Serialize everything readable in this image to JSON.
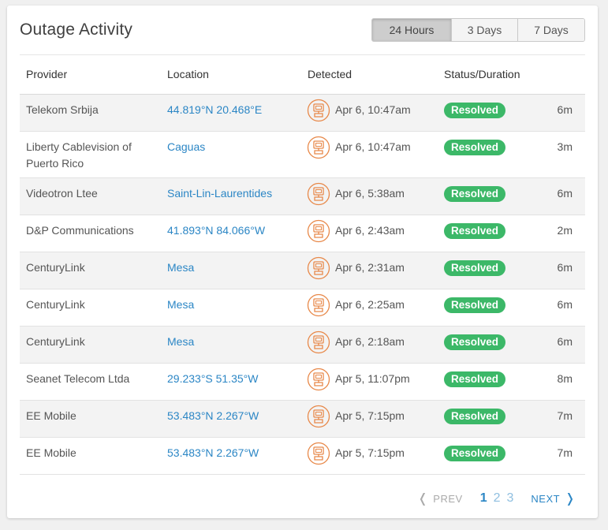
{
  "title": "Outage Activity",
  "range": {
    "options": [
      "24 Hours",
      "3 Days",
      "7 Days"
    ],
    "active": 0
  },
  "columns": [
    "Provider",
    "Location",
    "Detected",
    "Status/Duration"
  ],
  "colors": {
    "link": "#2b86c5",
    "resolved": "#3cb868",
    "icon": "#e8894a"
  },
  "rows": [
    {
      "provider": "Telekom Srbija",
      "location": "44.819°N 20.468°E",
      "detected": "Apr 6, 10:47am",
      "status": "Resolved",
      "duration": "6m"
    },
    {
      "provider": "Liberty Cablevision of Puerto Rico",
      "location": "Caguas",
      "detected": "Apr 6, 10:47am",
      "status": "Resolved",
      "duration": "3m"
    },
    {
      "provider": "Videotron Ltee",
      "location": "Saint-Lin-Laurentides",
      "detected": "Apr 6, 5:38am",
      "status": "Resolved",
      "duration": "6m"
    },
    {
      "provider": "D&P Communications",
      "location": "41.893°N 84.066°W",
      "detected": "Apr 6, 2:43am",
      "status": "Resolved",
      "duration": "2m"
    },
    {
      "provider": "CenturyLink",
      "location": "Mesa",
      "detected": "Apr 6, 2:31am",
      "status": "Resolved",
      "duration": "6m"
    },
    {
      "provider": "CenturyLink",
      "location": "Mesa",
      "detected": "Apr 6, 2:25am",
      "status": "Resolved",
      "duration": "6m"
    },
    {
      "provider": "CenturyLink",
      "location": "Mesa",
      "detected": "Apr 6, 2:18am",
      "status": "Resolved",
      "duration": "6m"
    },
    {
      "provider": "Seanet Telecom Ltda",
      "location": "29.233°S 51.35°W",
      "detected": "Apr 5, 11:07pm",
      "status": "Resolved",
      "duration": "8m"
    },
    {
      "provider": "EE Mobile",
      "location": "53.483°N 2.267°W",
      "detected": "Apr 5, 7:15pm",
      "status": "Resolved",
      "duration": "7m"
    },
    {
      "provider": "EE Mobile",
      "location": "53.483°N 2.267°W",
      "detected": "Apr 5, 7:15pm",
      "status": "Resolved",
      "duration": "7m"
    }
  ],
  "pagination": {
    "prev": "PREV",
    "next": "NEXT",
    "pages": [
      "1",
      "2",
      "3"
    ],
    "current": "1"
  }
}
